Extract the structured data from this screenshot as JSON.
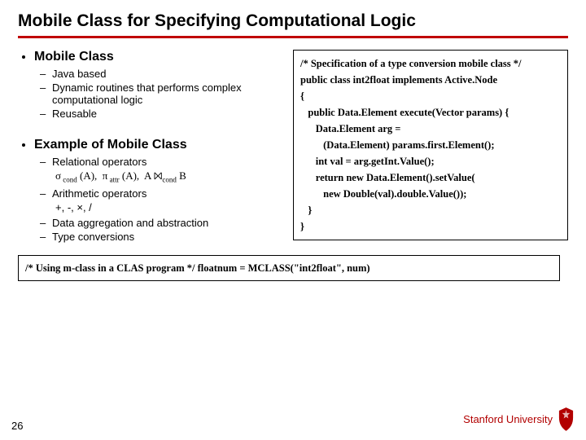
{
  "title": "Mobile Class for Specifying Computational Logic",
  "left": {
    "s1": "Mobile Class",
    "s1b1": "Java based",
    "s1b2": "Dynamic routines that performs complex computational logic",
    "s1b3": "Reusable",
    "s2": "Example of Mobile Class",
    "s2b1": "Relational operators",
    "s2b1sub": "σ cond (A),  π attr (A),  A ⨝cond B",
    "s2b2": "Arithmetic operators",
    "s2b2sub": "+, -, ×, /",
    "s2b3": "Data aggregation and abstraction",
    "s2b4": "Type conversions"
  },
  "code1": {
    "c0": "/* Specification of a type conversion mobile class */",
    "c1": "public class int2float implements Active.Node",
    "c2": "{",
    "c3": "   public Data.Element execute(Vector params) {",
    "c4": "      Data.Element arg =",
    "c5": "         (Data.Element) params.first.Element();",
    "c6": "      int val = arg.getInt.Value();",
    "c7": "      return new Data.Element().setValue(",
    "c8": "         new Double(val).double.Value());",
    "c9": "   }",
    "c10": "}"
  },
  "code2": {
    "l1": "/* Using m-class in a CLAS program */",
    "l2": "floatnum = MCLASS(\"int2float\", num)"
  },
  "footer": {
    "page": "26",
    "uni": "Stanford University"
  }
}
